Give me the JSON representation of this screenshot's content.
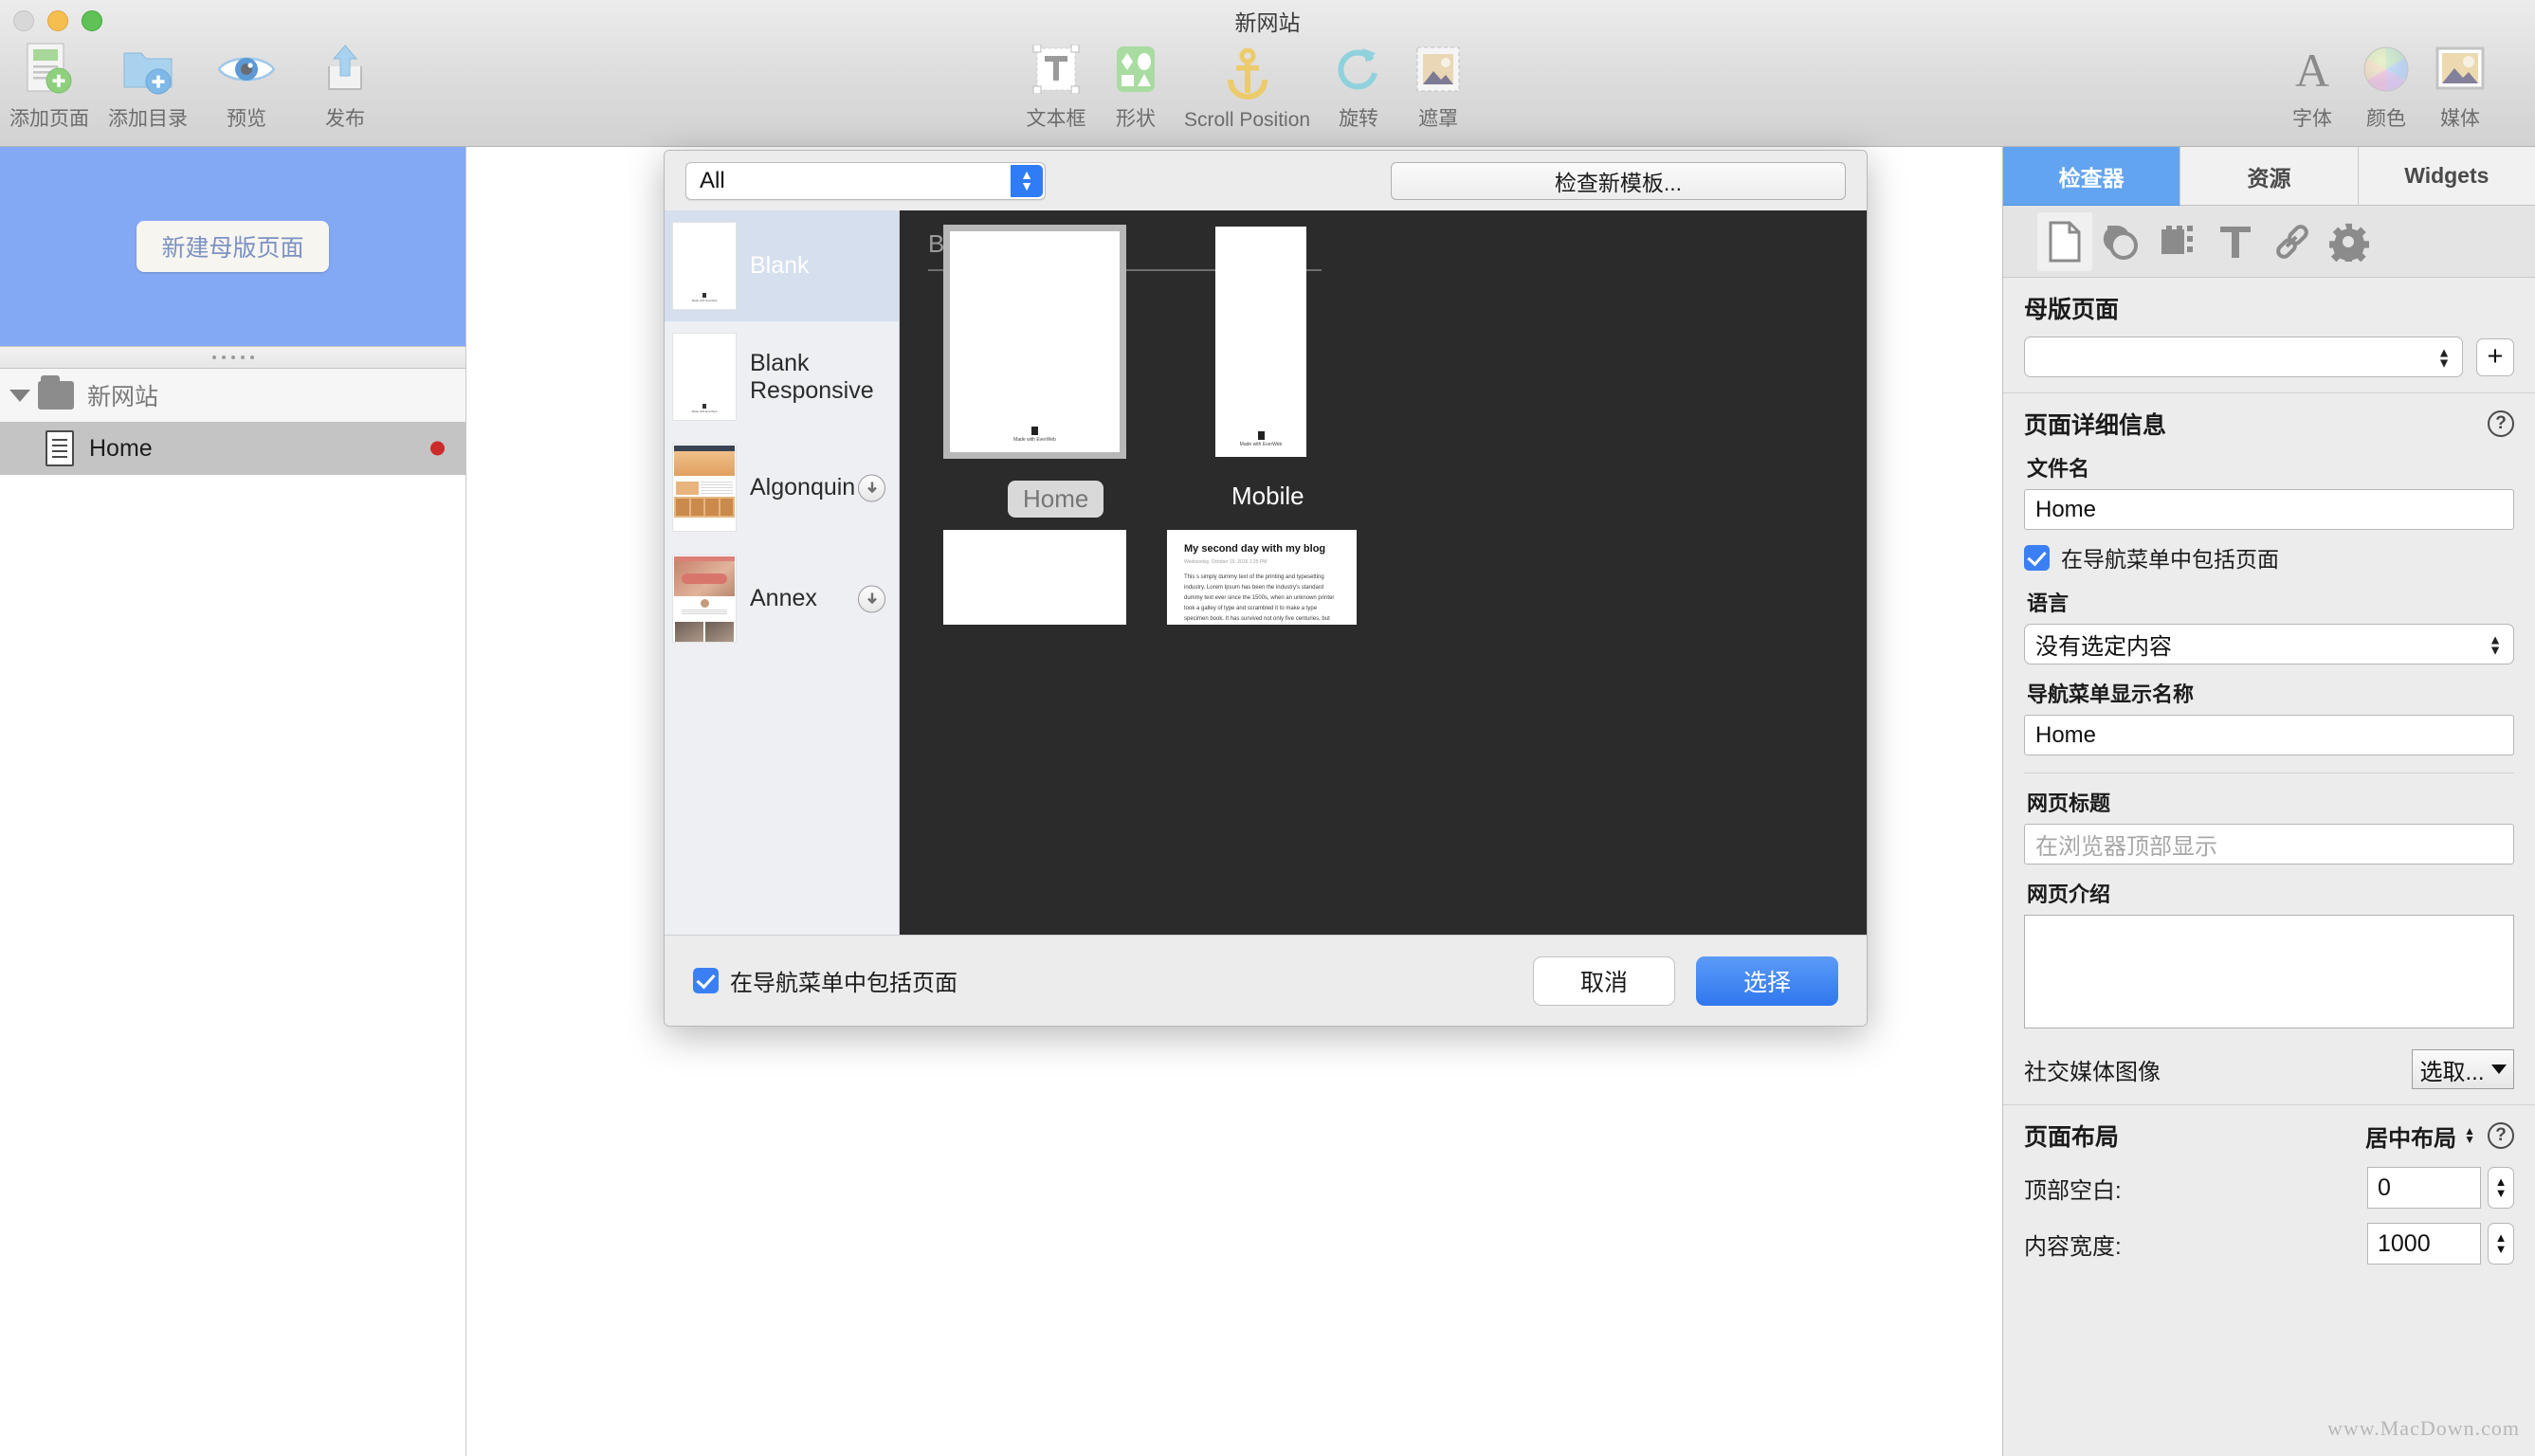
{
  "window": {
    "title": "新网站"
  },
  "toolbar": {
    "left": [
      {
        "label": "添加页面",
        "icon": "add-page-icon"
      },
      {
        "label": "添加目录",
        "icon": "add-folder-icon"
      },
      {
        "label": "预览",
        "icon": "preview-eye-icon"
      },
      {
        "label": "发布",
        "icon": "publish-upload-icon"
      }
    ],
    "center": [
      {
        "label": "文本框",
        "icon": "text-box-icon"
      },
      {
        "label": "形状",
        "icon": "shapes-icon"
      },
      {
        "label": "Scroll Position",
        "icon": "anchor-icon"
      },
      {
        "label": "旋转",
        "icon": "rotate-icon"
      },
      {
        "label": "遮罩",
        "icon": "mask-icon"
      }
    ],
    "right": [
      {
        "label": "字体",
        "icon": "font-icon"
      },
      {
        "label": "颜色",
        "icon": "color-wheel-icon"
      },
      {
        "label": "媒体",
        "icon": "media-icon"
      }
    ]
  },
  "sidebar": {
    "master_button": "新建母版页面",
    "tree": {
      "site_name": "新网站",
      "pages": [
        {
          "name": "Home",
          "modified": true
        }
      ]
    }
  },
  "dialog": {
    "filter": {
      "value": "All"
    },
    "check_templates_button": "检查新模板...",
    "templates": [
      {
        "name": "Blank",
        "selected": true,
        "downloadable": false
      },
      {
        "name": "Blank Responsive",
        "selected": false,
        "downloadable": false
      },
      {
        "name": "Algonquin",
        "selected": false,
        "downloadable": true
      },
      {
        "name": "Annex",
        "selected": false,
        "downloadable": true
      }
    ],
    "preview": {
      "title": "Blank",
      "desktop_caption": "Home",
      "mobile_caption": "Mobile",
      "page_footer_text": "Made with EverWeb",
      "blog_card": {
        "heading": "My second day with my blog",
        "date": "Wednesday, October 19, 2016 1:25 PM",
        "body": "This s simply dummy text of the printing and typesetting industry. Lorem Ipsum has been the industry's standard dummy text ever since the 1500s, when an unknown printer took a galley of type and scrambled it to make a type specimen book. It has survived not only five centuries, but also the leap into electronic typesetting, remaining essentially unchanged. It was popularised in the 1960s with the release of Letraset sheets containing Lorem Ipsum passages, and more recently with desktop publishing software like Aldus PageMaker including versions of Lorem Ipsum."
      }
    },
    "footer": {
      "include_in_nav_label": "在导航菜单中包括页面",
      "cancel_button": "取消",
      "choose_button": "选择"
    }
  },
  "inspector": {
    "tabs": [
      {
        "label": "检查器",
        "active": true
      },
      {
        "label": "资源",
        "active": false
      },
      {
        "label": "Widgets",
        "active": false
      }
    ],
    "icons": [
      {
        "name": "page-icon",
        "active": true
      },
      {
        "name": "shape-icon",
        "active": false
      },
      {
        "name": "selection-icon",
        "active": false
      },
      {
        "name": "text-icon",
        "active": false
      },
      {
        "name": "link-icon",
        "active": false
      },
      {
        "name": "gear-icon",
        "active": false
      }
    ],
    "master_page": {
      "title": "母版页面",
      "value": "",
      "add_button": "+"
    },
    "page_details": {
      "title": "页面详细信息",
      "help": "?",
      "filename_label": "文件名",
      "filename_value": "Home",
      "include_in_nav_label": "在导航菜单中包括页面",
      "language_label": "语言",
      "language_value": "没有选定内容",
      "nav_display_label": "导航菜单显示名称",
      "nav_display_value": "Home",
      "page_title_label": "网页标题",
      "page_title_placeholder": "在浏览器顶部显示",
      "page_desc_label": "网页介绍",
      "page_desc_value": "",
      "social_image_label": "社交媒体图像",
      "social_image_button": "选取..."
    },
    "page_layout": {
      "title": "页面布局",
      "layout_value": "居中布局",
      "help": "?",
      "top_margin_label": "顶部空白:",
      "top_margin_value": "0",
      "content_width_label": "内容宽度:",
      "content_width_value": "1000"
    }
  },
  "watermark": "www.MacDown.com",
  "colors": {
    "accent": "#3b7ff5",
    "master_area": "#84a9f4",
    "tab_active": "#63a4f0"
  }
}
